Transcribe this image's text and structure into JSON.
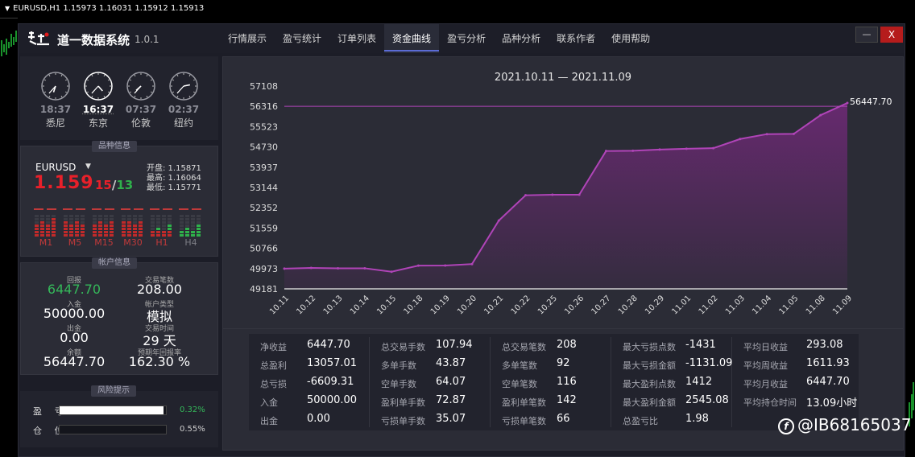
{
  "mt_bar": {
    "symbol_text": "EURUSD,H1  1.15973 1.16031 1.15912 1.15913"
  },
  "app": {
    "title": "道一数据系统",
    "version": "1.0.1"
  },
  "window": {
    "minimize_label": "—",
    "close_label": "X"
  },
  "tabs": [
    {
      "label": "行情展示"
    },
    {
      "label": "盈亏统计"
    },
    {
      "label": "订单列表"
    },
    {
      "label": "资金曲线",
      "active": true
    },
    {
      "label": "盈亏分析"
    },
    {
      "label": "品种分析"
    },
    {
      "label": "联系作者"
    },
    {
      "label": "使用帮助"
    }
  ],
  "clocks": [
    {
      "time": "18:37",
      "city": "悉尼",
      "hour": 18,
      "minute": 37
    },
    {
      "time": "16:37",
      "city": "东京",
      "hour": 16,
      "minute": 37,
      "active": true
    },
    {
      "time": "07:37",
      "city": "伦敦",
      "hour": 7,
      "minute": 37
    },
    {
      "time": "02:37",
      "city": "纽约",
      "hour": 2,
      "minute": 37
    }
  ],
  "symbol_panel": {
    "header": "品种信息",
    "symbol": "EURUSD",
    "price_main": "1.159",
    "price_bid": "15",
    "price_slash": "/",
    "price_ask": "13",
    "open": "开盘: 1.15871",
    "high": "最高: 1.16064",
    "low": "最低: 1.15771",
    "timeframes": [
      {
        "label": "M1",
        "bars": [
          0.55,
          0.7,
          0.5,
          0.75
        ],
        "color": "red"
      },
      {
        "label": "M5",
        "bars": [
          0.6,
          0.5,
          0.7,
          0.45
        ],
        "color": "red"
      },
      {
        "label": "M15",
        "bars": [
          0.5,
          0.65,
          0.45,
          0.7
        ],
        "color": "red"
      },
      {
        "label": "M30",
        "bars": [
          0.6,
          0.7,
          0.55,
          0.65
        ],
        "color": "red"
      },
      {
        "label": "H1",
        "bars": [
          0.2,
          0.3,
          0.15,
          0.45
        ],
        "color": "mixed"
      },
      {
        "label": "H4",
        "bars": [
          0.15,
          0.35,
          0.25,
          0.5
        ],
        "color": "green"
      }
    ]
  },
  "account_panel": {
    "header": "帐户信息",
    "items": [
      {
        "label": "回报",
        "value": "6447.70",
        "green": true
      },
      {
        "label": "交易笔数",
        "value": "208.00"
      },
      {
        "label": "入金",
        "value": "50000.00"
      },
      {
        "label": "帐户类型",
        "value": "模拟"
      },
      {
        "label": "出金",
        "value": "0.00"
      },
      {
        "label": "交易时间",
        "value": "29 天"
      },
      {
        "label": "余额",
        "value": "56447.70"
      },
      {
        "label": "预期年回报率",
        "value": "162.30 %"
      }
    ]
  },
  "risk_panel": {
    "header": "风险提示",
    "rows": [
      {
        "label": "盈 亏",
        "pct": "0.32%",
        "fill": 0.98,
        "color": "#35b85a"
      },
      {
        "label": "仓 位",
        "pct": "0.55%",
        "fill": 0.0,
        "color": "#cfcfcf"
      }
    ]
  },
  "chart_data": {
    "type": "area",
    "title": "2021.10.11 — 2021.11.09",
    "x": [
      "10.11",
      "10.12",
      "10.13",
      "10.14",
      "10.15",
      "10.18",
      "10.19",
      "10.20",
      "10.21",
      "10.22",
      "10.25",
      "10.26",
      "10.27",
      "10.28",
      "10.29",
      "11.01",
      "11.02",
      "11.03",
      "11.04",
      "11.05",
      "11.08",
      "11.09"
    ],
    "values": [
      49973,
      50000,
      49985,
      49985,
      49850,
      50090,
      50095,
      50150,
      51850,
      52840,
      52860,
      52860,
      54570,
      54580,
      54625,
      54660,
      54680,
      55040,
      55230,
      55240,
      55970,
      56447.7
    ],
    "yticks": [
      49181,
      49973,
      50766,
      51559,
      52352,
      53144,
      53937,
      54730,
      55523,
      56316,
      57108
    ],
    "ylim": [
      49181,
      57108
    ],
    "last_label": "56447.70",
    "ref_line": 56316,
    "line_color": "#b044b8",
    "fill_color": "#6a2a72"
  },
  "stats": {
    "columns": [
      [
        {
          "label": "净收益",
          "value": "6447.70"
        },
        {
          "label": "总盈利",
          "value": "13057.01"
        },
        {
          "label": "总亏损",
          "value": "-6609.31"
        },
        {
          "label": "入金",
          "value": "50000.00"
        },
        {
          "label": "出金",
          "value": "0.00"
        }
      ],
      [
        {
          "label": "总交易手数",
          "value": "107.94"
        },
        {
          "label": "多单手数",
          "value": "43.87"
        },
        {
          "label": "空单手数",
          "value": "64.07"
        },
        {
          "label": "盈利单手数",
          "value": "72.87"
        },
        {
          "label": "亏损单手数",
          "value": "35.07"
        }
      ],
      [
        {
          "label": "总交易笔数",
          "value": "208"
        },
        {
          "label": "多单笔数",
          "value": "92"
        },
        {
          "label": "空单笔数",
          "value": "116"
        },
        {
          "label": "盈利单笔数",
          "value": "142"
        },
        {
          "label": "亏损单笔数",
          "value": "66"
        }
      ],
      [
        {
          "label": "最大亏损点数",
          "value": "-1431"
        },
        {
          "label": "最大亏损金额",
          "value": "-1131.09"
        },
        {
          "label": "最大盈利点数",
          "value": "1412"
        },
        {
          "label": "最大盈利金额",
          "value": "2545.08"
        },
        {
          "label": "总盈亏比",
          "value": "1.98"
        }
      ],
      [
        {
          "label": "平均日收益",
          "value": "293.08"
        },
        {
          "label": "平均周收益",
          "value": "1611.93"
        },
        {
          "label": "平均月收益",
          "value": "6447.70"
        },
        {
          "label": "平均持仓时间",
          "value": "13.09小时"
        }
      ]
    ]
  },
  "watermark": {
    "icon": "f",
    "text": "@IB68165037"
  }
}
